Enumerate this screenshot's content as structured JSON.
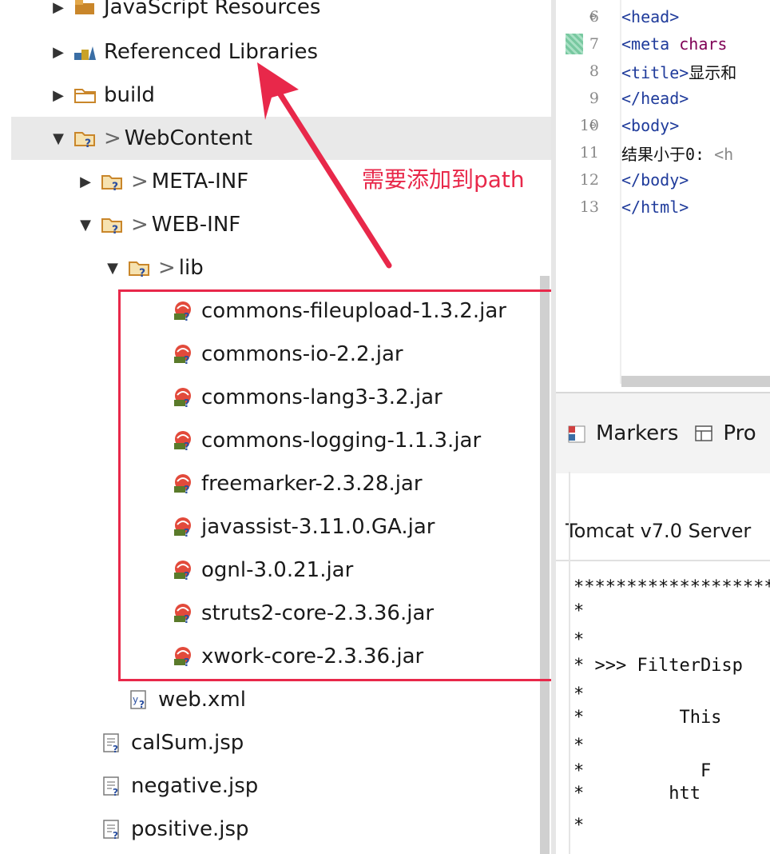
{
  "explorer": {
    "items": [
      {
        "label": "JavaScript Resources",
        "decor": "",
        "arrow": "expand",
        "icon": "js-resources-icon",
        "indent": 0,
        "selected": false
      },
      {
        "label": "Referenced Libraries",
        "decor": "",
        "arrow": "expand",
        "icon": "libraries-icon",
        "indent": 0,
        "selected": false
      },
      {
        "label": "build",
        "decor": "",
        "arrow": "expand",
        "icon": "folder-icon",
        "indent": 0,
        "selected": false
      },
      {
        "label": "WebContent",
        "decor": ">",
        "arrow": "collapse",
        "icon": "folder-unknown-icon",
        "indent": 0,
        "selected": true
      },
      {
        "label": "META-INF",
        "decor": ">",
        "arrow": "expand",
        "icon": "folder-unknown-icon",
        "indent": 1,
        "selected": false
      },
      {
        "label": "WEB-INF",
        "decor": ">",
        "arrow": "collapse",
        "icon": "folder-unknown-icon",
        "indent": 1,
        "selected": false
      },
      {
        "label": "lib",
        "decor": ">",
        "arrow": "collapse",
        "icon": "folder-unknown-icon",
        "indent": 2,
        "selected": false
      },
      {
        "label": "commons-fileupload-1.3.2.jar",
        "decor": "",
        "arrow": "none",
        "icon": "jar-icon",
        "indent": 3,
        "selected": false
      },
      {
        "label": "commons-io-2.2.jar",
        "decor": "",
        "arrow": "none",
        "icon": "jar-icon",
        "indent": 3,
        "selected": false
      },
      {
        "label": "commons-lang3-3.2.jar",
        "decor": "",
        "arrow": "none",
        "icon": "jar-icon",
        "indent": 3,
        "selected": false
      },
      {
        "label": "commons-logging-1.1.3.jar",
        "decor": "",
        "arrow": "none",
        "icon": "jar-icon",
        "indent": 3,
        "selected": false
      },
      {
        "label": "freemarker-2.3.28.jar",
        "decor": "",
        "arrow": "none",
        "icon": "jar-icon",
        "indent": 3,
        "selected": false
      },
      {
        "label": "javassist-3.11.0.GA.jar",
        "decor": "",
        "arrow": "none",
        "icon": "jar-icon",
        "indent": 3,
        "selected": false
      },
      {
        "label": "ognl-3.0.21.jar",
        "decor": "",
        "arrow": "none",
        "icon": "jar-icon",
        "indent": 3,
        "selected": false
      },
      {
        "label": "struts2-core-2.3.36.jar",
        "decor": "",
        "arrow": "none",
        "icon": "jar-icon",
        "indent": 3,
        "selected": false
      },
      {
        "label": "xwork-core-2.3.36.jar",
        "decor": "",
        "arrow": "none",
        "icon": "jar-icon",
        "indent": 3,
        "selected": false
      },
      {
        "label": "web.xml",
        "decor": "",
        "arrow": "none",
        "icon": "xml-file-icon",
        "indent": 2,
        "selected": false
      },
      {
        "label": "calSum.jsp",
        "decor": "",
        "arrow": "none",
        "icon": "jsp-file-icon",
        "indent": 1,
        "selected": false
      },
      {
        "label": "negative.jsp",
        "decor": "",
        "arrow": "none",
        "icon": "jsp-file-icon",
        "indent": 1,
        "selected": false
      },
      {
        "label": "positive.jsp",
        "decor": "",
        "arrow": "none",
        "icon": "jsp-file-icon",
        "indent": 1,
        "selected": false
      }
    ]
  },
  "annotation": {
    "text": "需要添加到path",
    "color": "#e8284a"
  },
  "editor": {
    "lines": [
      {
        "num": "6",
        "fold": true,
        "parts": [
          {
            "t": "<head>",
            "c": "code"
          }
        ]
      },
      {
        "num": "7",
        "fold": false,
        "parts": [
          {
            "t": "<meta ",
            "c": "code"
          },
          {
            "t": "chars",
            "c": "attr"
          }
        ]
      },
      {
        "num": "8",
        "fold": false,
        "parts": [
          {
            "t": "<title>",
            "c": "code"
          },
          {
            "t": "显示和",
            "c": "plain"
          }
        ]
      },
      {
        "num": "9",
        "fold": false,
        "parts": [
          {
            "t": "</head>",
            "c": "code"
          }
        ]
      },
      {
        "num": "10",
        "fold": true,
        "parts": [
          {
            "t": "<body>",
            "c": "code"
          }
        ]
      },
      {
        "num": "11",
        "fold": false,
        "parts": [
          {
            "t": "结果小于0: ",
            "c": "plain"
          },
          {
            "t": "<h",
            "c": "gray"
          }
        ]
      },
      {
        "num": "12",
        "fold": false,
        "parts": [
          {
            "t": "</body>",
            "c": "code"
          }
        ]
      },
      {
        "num": "13",
        "fold": false,
        "parts": [
          {
            "t": "</html>",
            "c": "code"
          }
        ]
      }
    ]
  },
  "views": {
    "tabs": [
      {
        "label": "Markers",
        "icon": "markers-icon"
      },
      {
        "label": "Pro",
        "icon": "properties-icon"
      }
    ],
    "console_title": "Tomcat v7.0 Server",
    "console_lines": [
      "*******************",
      "*",
      "*",
      "* >>> FilterDisp",
      "*",
      "*         This",
      "*",
      "*           F",
      "*        htt",
      "*"
    ]
  },
  "colors": {
    "accent_red": "#e8284a",
    "selected_row": "#e9e9e9",
    "tag_blue": "#1f3b9b"
  }
}
